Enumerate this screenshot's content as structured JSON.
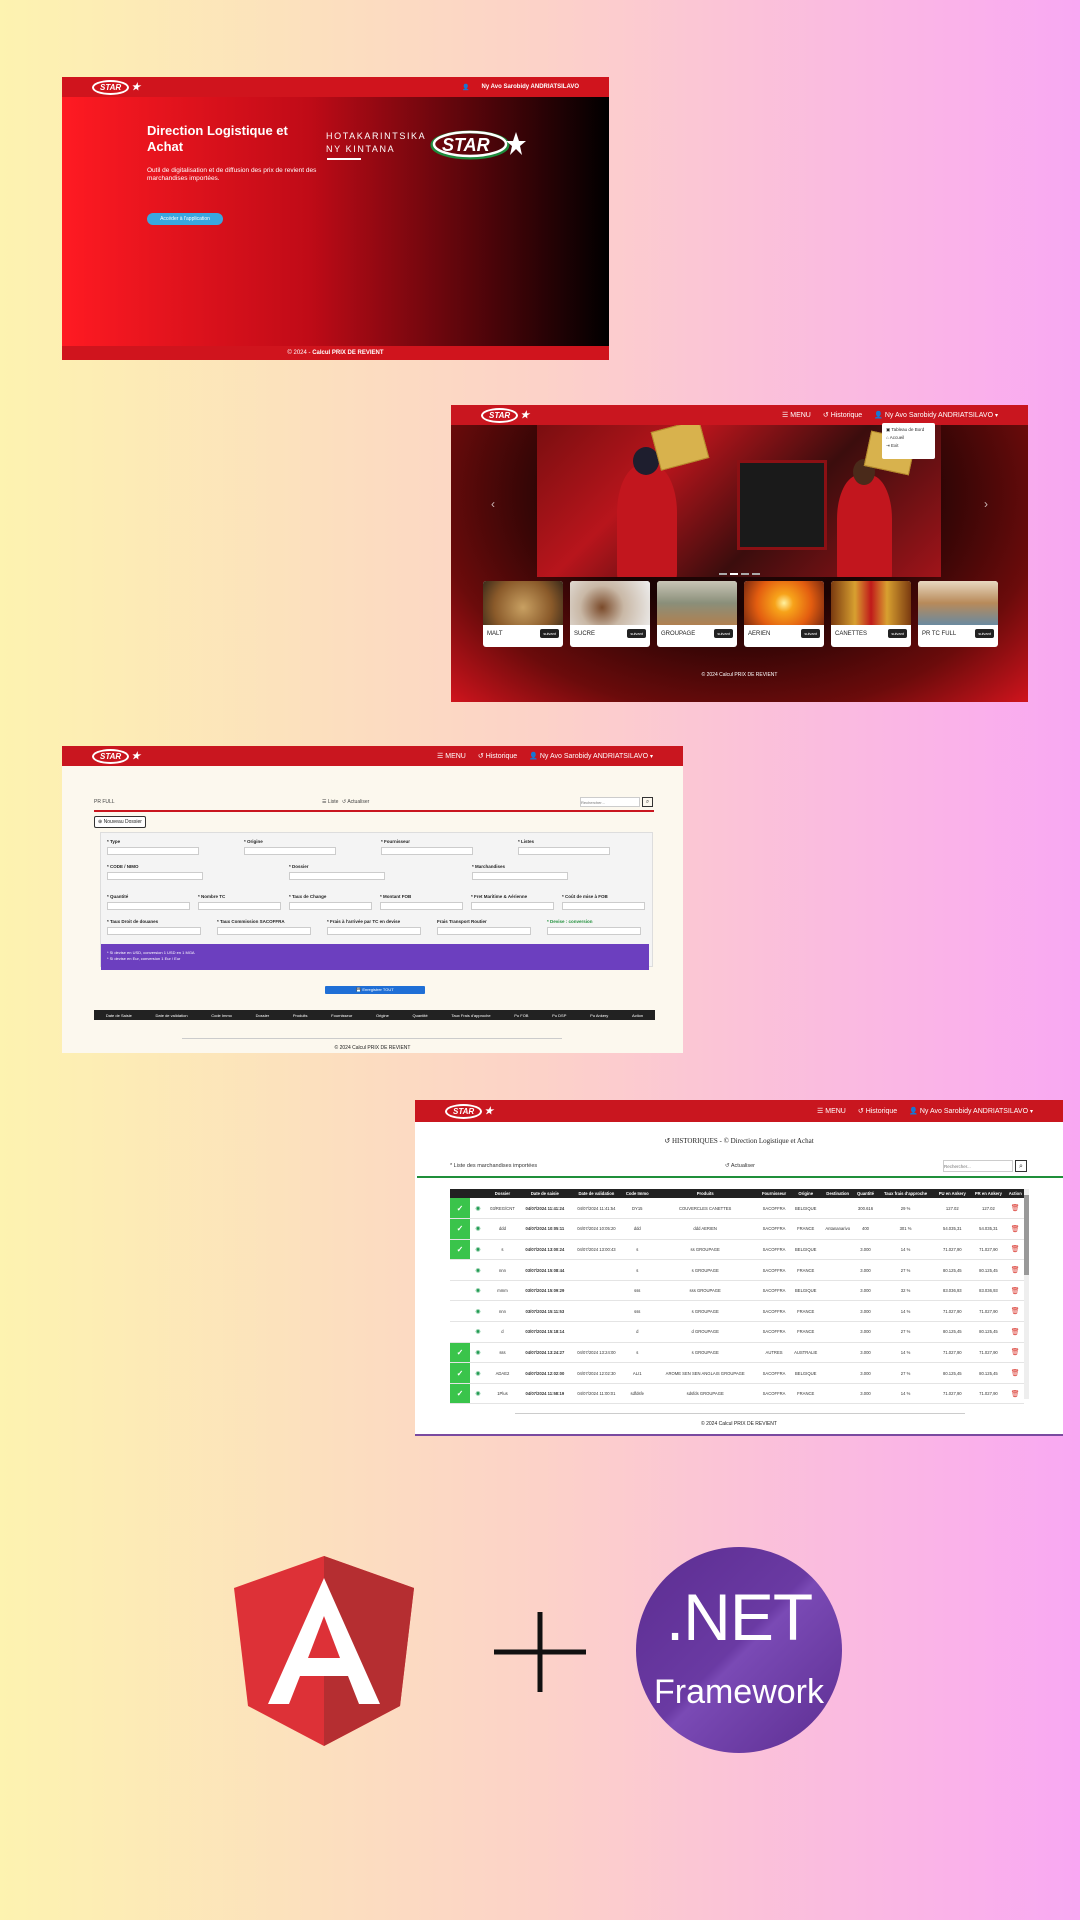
{
  "user_name": "Ny Avo Sarobidy ANDRIATSILAVO",
  "brand": "STAR",
  "screen1": {
    "title": "Direction Logistique et Achat",
    "subtitle": "Outil de digitalisation et de diffusion des prix de revient des marchandises importées.",
    "button": "Accéder à l'application",
    "tagline_1": "HOTAKARINTSIKA",
    "tagline_2": "NY KINTANA",
    "footer_prefix": "© 2024 -",
    "footer_app": "Calcul PRIX DE REVIENT"
  },
  "screen2": {
    "nav": {
      "menu": "MENU",
      "history": "Historique"
    },
    "dropdown": [
      "Tableau de Bord",
      "Accueil",
      "Exit"
    ],
    "cards": [
      {
        "label": "MALT",
        "button": "suivant"
      },
      {
        "label": "SUCRE",
        "button": "suivant"
      },
      {
        "label": "GROUPAGE",
        "button": "suivant"
      },
      {
        "label": "AERIEN",
        "button": "suivant"
      },
      {
        "label": "CANETTES",
        "button": "suivant"
      },
      {
        "label": "PR TC FULL",
        "button": "suivant"
      }
    ],
    "footer": "© 2024 Calcul PRIX DE REVIENT"
  },
  "screen3": {
    "nav": {
      "menu": "MENU",
      "history": "Historique"
    },
    "section": "PR FULL",
    "list": "Liste",
    "refresh": "Actualiser",
    "search_placeholder": "Rechercher...",
    "new_button": "Nouveau Dossier",
    "fields_row1": [
      "* Type",
      "* Origine",
      "* Fournisseur",
      "* Listes"
    ],
    "fields_row2": [
      "* CODE / NIMO",
      "* Dossier",
      "* Marchandises"
    ],
    "fields_row3": [
      "* Quantité",
      "* Nombre TC",
      "* Taux de Change",
      "* Montant FOB",
      "* Fret Maritime & Aérienne",
      "* Coût de mise à FOB"
    ],
    "fields_row4": [
      "* Taux Droit de douanes",
      "* Taux Commission SACOFFRA",
      "* Frais à l'arrivée par TC en devise",
      "Frais Transport Routier",
      "* Devise : conversion"
    ],
    "notes": [
      "* Si devise en USD, conversion 1 USD en 1 MGA",
      "* Si devise en Eur, conversion 1 Eur / Eur"
    ],
    "save_button": "Enregistrer TOUT",
    "table_headers": [
      "Date de Saisie",
      "Date de validation",
      "Code Immo",
      "Dossier",
      "Produits",
      "Fournisseur",
      "Origine",
      "Quantité",
      "Taux Frais d'approche",
      "Pu FOB",
      "Pu DSP",
      "Pu Ankery",
      "Action"
    ],
    "footer": "© 2024 Calcul PRIX DE REVIENT"
  },
  "screen4": {
    "nav": {
      "menu": "MENU",
      "history": "Historique"
    },
    "title": "HISTORIQUES - © Direction Logistique et Achat",
    "subtitle": "Liste des marchandises importées",
    "refresh": "Actualiser",
    "search_placeholder": "Rechercher...",
    "headers": [
      "",
      "",
      "Dossier",
      "Date de saisie",
      "Date de validation",
      "Code Immo",
      "Produits",
      "Fournisseur",
      "Origine",
      "Destination",
      "Quantité",
      "Taux frais d'approche",
      "PU en Ankery",
      "PR en Ankery",
      "Action"
    ],
    "rows": [
      {
        "ok": true,
        "dossier": "03/REG/CNT",
        "saisie": "04/07/2024 11:41:24",
        "validation": "04/07/2024 11:41:54",
        "code": "DY15",
        "produit": "COUVERCLES CANETTES",
        "fournisseur": "SACOFFRA",
        "origine": "BELGIQUE",
        "destination": "",
        "qte": "300.616",
        "taux": "29 %",
        "pu": "127.02",
        "pr": "127.02"
      },
      {
        "ok": true,
        "dossier": "ddd",
        "saisie": "04/07/2024 10:05:11",
        "validation": "04/07/2024 10:05:20",
        "code": "ddd",
        "produit": "ddd AERIEN",
        "fournisseur": "SACOFFRA",
        "origine": "FRANCE",
        "destination": "Antananarivo",
        "qte": "400",
        "taux": "301 %",
        "pu": "54.035,31",
        "pr": "54.035,31"
      },
      {
        "ok": true,
        "dossier": "s",
        "saisie": "04/07/2024 13:00:24",
        "validation": "04/07/2024 13:00:43",
        "code": "s",
        "produit": "ss GROUPAGE",
        "fournisseur": "SACOFFRA",
        "origine": "BELGIQUE",
        "destination": "",
        "qte": "3.000",
        "taux": "14 %",
        "pu": "71.027,90",
        "pr": "71.027,90"
      },
      {
        "ok": false,
        "dossier": "nnn",
        "saisie": "03/07/2024 15:08:44",
        "validation": "",
        "code": "s",
        "produit": "s GROUPAGE",
        "fournisseur": "SACOFFRA",
        "origine": "FRANCE",
        "destination": "",
        "qte": "3.000",
        "taux": "27 %",
        "pu": "80.125,45",
        "pr": "80.125,45"
      },
      {
        "ok": false,
        "dossier": "mmm",
        "saisie": "03/07/2024 15:09:29",
        "validation": "",
        "code": "sss",
        "produit": "sss GROUPAGE",
        "fournisseur": "SACOFFRA",
        "origine": "BELGIQUE",
        "destination": "",
        "qte": "3.000",
        "taux": "32 %",
        "pu": "83.036,93",
        "pr": "83.036,93"
      },
      {
        "ok": false,
        "dossier": "nnn",
        "saisie": "03/07/2024 15:11:53",
        "validation": "",
        "code": "sss",
        "produit": "s GROUPAGE",
        "fournisseur": "SACOFFRA",
        "origine": "FRANCE",
        "destination": "",
        "qte": "3.000",
        "taux": "14 %",
        "pu": "71.027,90",
        "pr": "71.027,90"
      },
      {
        "ok": false,
        "dossier": "d",
        "saisie": "03/07/2024 15:18:14",
        "validation": "",
        "code": "d",
        "produit": "d GROUPAGE",
        "fournisseur": "SACOFFRA",
        "origine": "FRANCE",
        "destination": "",
        "qte": "3.000",
        "taux": "27 %",
        "pu": "80.125,45",
        "pr": "80.125,45"
      },
      {
        "ok": true,
        "dossier": "sss",
        "saisie": "04/07/2024 13:24:27",
        "validation": "04/07/2024 13:24:00",
        "code": "s",
        "produit": "s GROUPAGE",
        "fournisseur": "AUTRES",
        "origine": "AUSTRALIE",
        "destination": "",
        "qte": "3.000",
        "taux": "14 %",
        "pu": "71.027,90",
        "pr": "71.027,90"
      },
      {
        "ok": true,
        "dossier": "ADAE2",
        "saisie": "04/07/2024 12:02:00",
        "validation": "04/07/2024 12:02:30",
        "code": "ALI1",
        "produit": "AROME SEN SEN ANGLAIS GROUPAGE",
        "fournisseur": "SACOFFRA",
        "origine": "BELGIQUE",
        "destination": "",
        "qte": "3.000",
        "taux": "27 %",
        "pu": "80.125,45",
        "pr": "80.125,45"
      },
      {
        "ok": true,
        "dossier": "1Plus",
        "saisie": "04/07/2024 11:58:19",
        "validation": "04/07/2024 11:00:01",
        "code": "sdfdsfe",
        "produit": "sdsfds GROUPAGE",
        "fournisseur": "SACOFFRA",
        "origine": "FRANCE",
        "destination": "",
        "qte": "3.000",
        "taux": "14 %",
        "pu": "71.027,90",
        "pr": "71.027,90"
      }
    ],
    "footer": "© 2024 Calcul PRIX DE REVIENT"
  },
  "logos": {
    "net_line1": ".NET",
    "net_line2": "Framework",
    "plus": "+"
  },
  "colors": {
    "brand_red": "#c9161f",
    "angular_red": "#dd3137",
    "net_purple": "#5c2d91",
    "check_green": "#3ac44b"
  }
}
